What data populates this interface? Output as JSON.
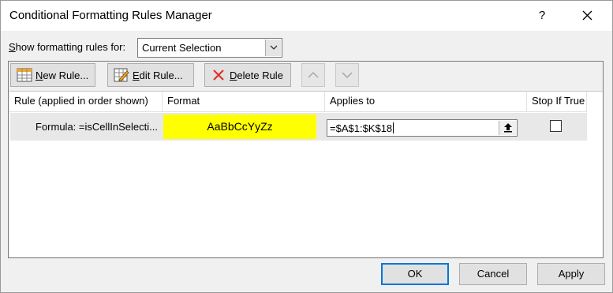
{
  "window": {
    "title": "Conditional Formatting Rules Manager",
    "help_label": "?"
  },
  "show_rules": {
    "label_prefix": "",
    "label_underlined": "S",
    "label_rest": "how formatting rules for:",
    "selected": "Current Selection"
  },
  "toolbar": {
    "new_rule": {
      "underline": "N",
      "rest": "ew Rule..."
    },
    "edit_rule": {
      "underline": "E",
      "rest": "dit Rule..."
    },
    "delete_rule": {
      "underline": "D",
      "rest": "elete Rule"
    }
  },
  "table": {
    "headers": [
      "Rule (applied in order shown)",
      "Format",
      "Applies to",
      "Stop If True"
    ],
    "rows": [
      {
        "rule": "Formula: =isCellInSelecti...",
        "format_preview": "AaBbCcYyZz",
        "applies_to": "=$A$1:$K$18",
        "stop_if_true": false
      }
    ]
  },
  "buttons": {
    "ok": "OK",
    "cancel": "Cancel",
    "apply": "Apply"
  },
  "colors": {
    "format_fill": "#ffff00",
    "default_button_border": "#0078d7",
    "dialog_bg": "#f0f0f0"
  }
}
